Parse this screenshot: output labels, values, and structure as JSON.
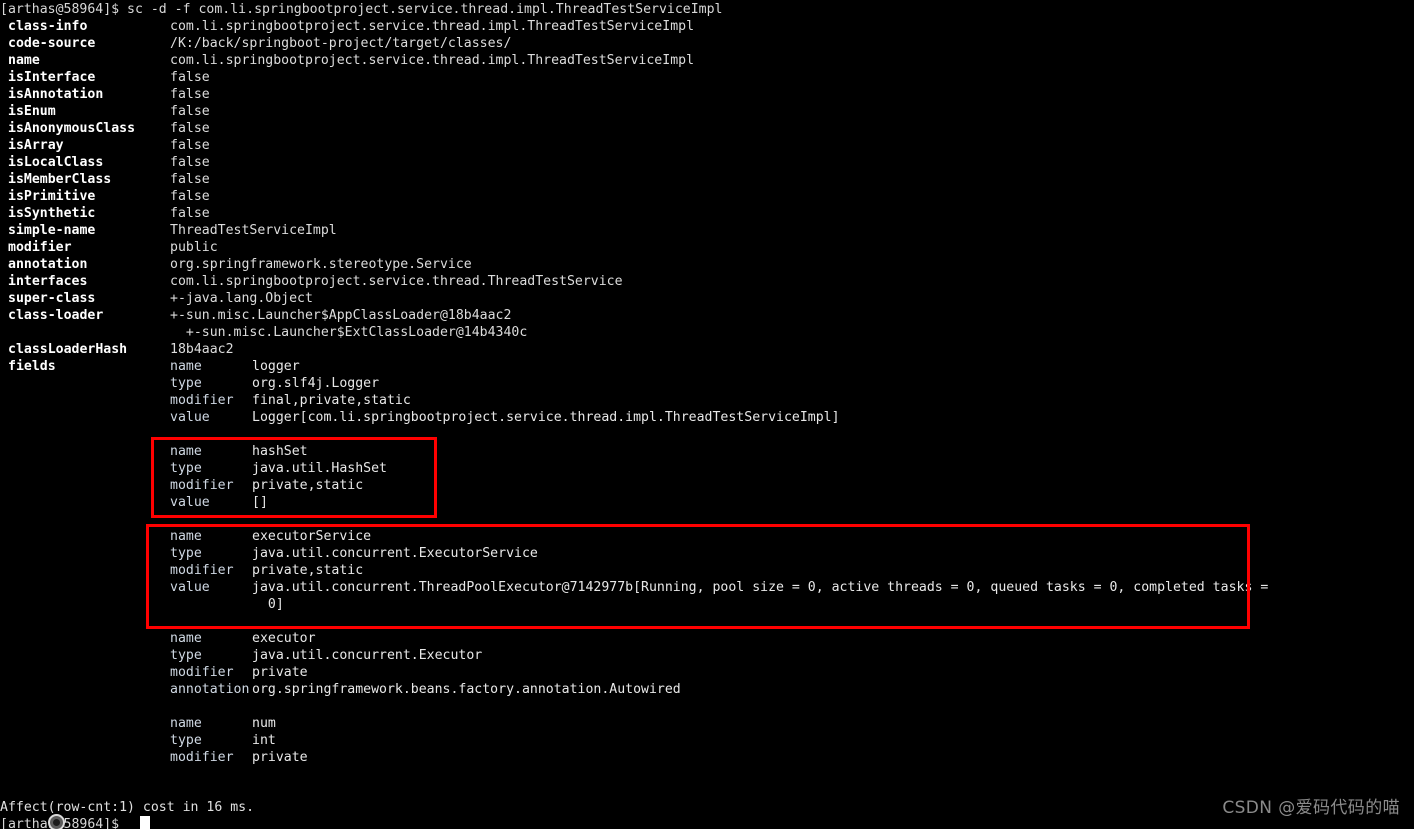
{
  "terminal": {
    "background": "#000000",
    "foreground": "#e6e6e6",
    "highlight_color": "#ff0000",
    "prompt_top": "[arthas@58964]$ sc -d -f com.li.springbootproject.service.thread.impl.ThreadTestServiceImpl",
    "prompt_bottom": "[arthas@58964]$",
    "status_line": "Affect(row-cnt:1) cost in 16 ms."
  },
  "class_info": {
    "rows": [
      {
        "key": "class-info",
        "value": "com.li.springbootproject.service.thread.impl.ThreadTestServiceImpl"
      },
      {
        "key": "code-source",
        "value": "/K:/back/springboot-project/target/classes/"
      },
      {
        "key": "name",
        "value": "com.li.springbootproject.service.thread.impl.ThreadTestServiceImpl"
      },
      {
        "key": "isInterface",
        "value": "false"
      },
      {
        "key": "isAnnotation",
        "value": "false"
      },
      {
        "key": "isEnum",
        "value": "false"
      },
      {
        "key": "isAnonymousClass",
        "value": "false"
      },
      {
        "key": "isArray",
        "value": "false"
      },
      {
        "key": "isLocalClass",
        "value": "false"
      },
      {
        "key": "isMemberClass",
        "value": "false"
      },
      {
        "key": "isPrimitive",
        "value": "false"
      },
      {
        "key": "isSynthetic",
        "value": "false"
      },
      {
        "key": "simple-name",
        "value": "ThreadTestServiceImpl"
      },
      {
        "key": "modifier",
        "value": "public"
      },
      {
        "key": "annotation",
        "value": "org.springframework.stereotype.Service"
      },
      {
        "key": "interfaces",
        "value": "com.li.springbootproject.service.thread.ThreadTestService"
      },
      {
        "key": "super-class",
        "value": "+-java.lang.Object"
      },
      {
        "key": "class-loader",
        "value": "+-sun.misc.Launcher$AppClassLoader@18b4aac2"
      },
      {
        "key": "",
        "value": "  +-sun.misc.Launcher$ExtClassLoader@14b4340c"
      },
      {
        "key": "classLoaderHash",
        "value": "18b4aac2"
      },
      {
        "key": "fields",
        "value": ""
      }
    ]
  },
  "fields": [
    {
      "id": "logger",
      "highlighted": false,
      "rows": [
        {
          "key": "name",
          "value": "logger"
        },
        {
          "key": "type",
          "value": "org.slf4j.Logger"
        },
        {
          "key": "modifier",
          "value": "final,private,static"
        },
        {
          "key": "value",
          "value": "Logger[com.li.springbootproject.service.thread.impl.ThreadTestServiceImpl]"
        }
      ]
    },
    {
      "id": "hashSet",
      "highlighted": true,
      "rows": [
        {
          "key": "name",
          "value": "hashSet"
        },
        {
          "key": "type",
          "value": "java.util.HashSet"
        },
        {
          "key": "modifier",
          "value": "private,static"
        },
        {
          "key": "value",
          "value": "[]"
        }
      ]
    },
    {
      "id": "executorService",
      "highlighted": true,
      "rows": [
        {
          "key": "name",
          "value": "executorService"
        },
        {
          "key": "type",
          "value": "java.util.concurrent.ExecutorService"
        },
        {
          "key": "modifier",
          "value": "private,static"
        },
        {
          "key": "value",
          "value": "java.util.concurrent.ThreadPoolExecutor@7142977b[Running, pool size = 0, active threads = 0, queued tasks = 0, completed tasks ="
        },
        {
          "key": "",
          "value": "  0]"
        }
      ]
    },
    {
      "id": "executor",
      "highlighted": false,
      "rows": [
        {
          "key": "name",
          "value": "executor"
        },
        {
          "key": "type",
          "value": "java.util.concurrent.Executor"
        },
        {
          "key": "modifier",
          "value": "private"
        },
        {
          "key": "annotation",
          "value": "org.springframework.beans.factory.annotation.Autowired"
        }
      ]
    },
    {
      "id": "num",
      "highlighted": false,
      "rows": [
        {
          "key": "name",
          "value": "num"
        },
        {
          "key": "type",
          "value": "int"
        },
        {
          "key": "modifier",
          "value": "private"
        }
      ]
    }
  ],
  "watermark": {
    "text": "CSDN @爱码代码的喵"
  }
}
